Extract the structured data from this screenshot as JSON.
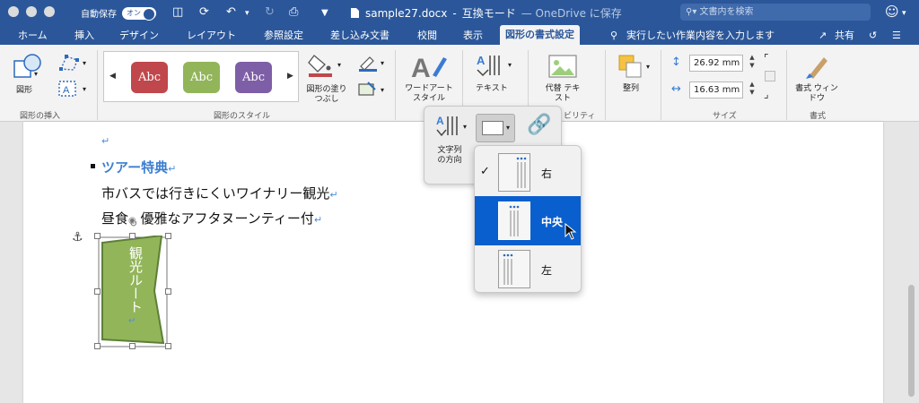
{
  "window": {
    "autosave_label": "自動保存",
    "autosave_state": "オン",
    "filename": "sample27.docx",
    "separator": "-",
    "mode": "互換モード",
    "cloud_status": "— OneDrive に保存",
    "search_placeholder": "文書内を検索"
  },
  "tabs": [
    {
      "label": "ホーム"
    },
    {
      "label": "挿入"
    },
    {
      "label": "デザイン"
    },
    {
      "label": "レイアウト"
    },
    {
      "label": "参照設定"
    },
    {
      "label": "差し込み文書"
    },
    {
      "label": "校閲"
    },
    {
      "label": "表示"
    },
    {
      "label": "図形の書式設定",
      "active": true
    }
  ],
  "tell_me": "実行したい作業内容を入力します",
  "share_label": "共有",
  "ribbon": {
    "insert_shapes": {
      "shape_label": "図形",
      "group_label": "図形の挿入"
    },
    "shape_styles": {
      "group_label": "図形のスタイル",
      "styles": [
        {
          "text": "Abc",
          "color": "#c0474b"
        },
        {
          "text": "Abc",
          "color": "#93b55a"
        },
        {
          "text": "Abc",
          "color": "#7e5ea6"
        }
      ],
      "fill_label": "図形の塗りつぶし"
    },
    "wordart_label": "ワードアート スタイル",
    "text_label": "テキスト",
    "alt_text_label": "代替 テキスト",
    "accessibility_label": "ビリティ",
    "arrange_label": "整列",
    "size": {
      "height": "26.92 mm",
      "width": "16.63 mm",
      "group_label": "サイズ"
    },
    "format_pane": {
      "label": "書式 ウィンドウ",
      "group_label": "書式"
    }
  },
  "document": {
    "heading": "ツアー特典",
    "line1": "市バスでは行きにくいワイナリー観光",
    "line2_a": "昼食",
    "line2_b": "優雅なアフタヌーンティー付",
    "shape_text": "観光ルート",
    "shape_color": "#93b55a"
  },
  "popup": {
    "direction_label": "文字列 の方向"
  },
  "align_menu": {
    "options": [
      {
        "label": "右",
        "checked": true
      },
      {
        "label": "中央",
        "selected": true
      },
      {
        "label": "左"
      }
    ]
  },
  "colors": {
    "brand": "#2b579a",
    "selection": "#0a5fce",
    "heading": "#3c7dd1"
  }
}
